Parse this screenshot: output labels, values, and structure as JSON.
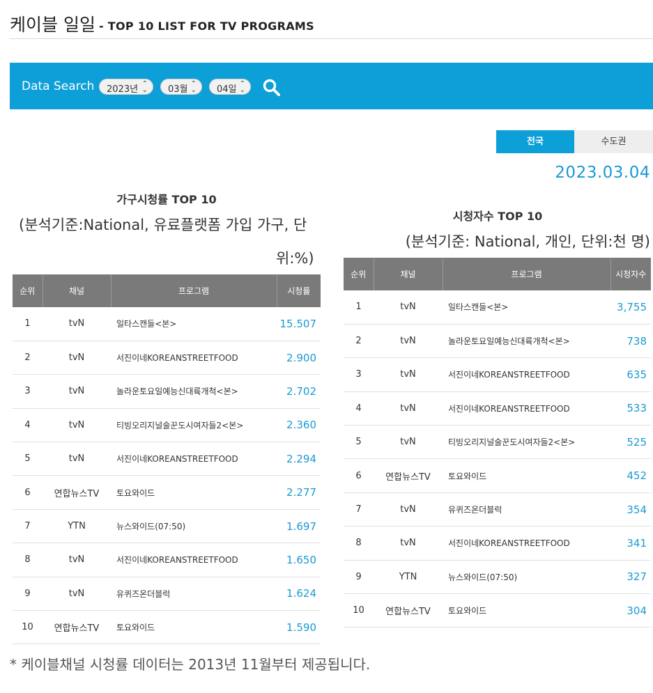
{
  "header": {
    "title_ko": "케이블 일일",
    "title_en": "- TOP 10 LIST FOR TV PROGRAMS"
  },
  "search": {
    "label": "Data Search",
    "year": "2023년",
    "month": "03월",
    "day": "04일",
    "icon": "search-icon"
  },
  "tabs": {
    "national": "전국",
    "capital": "수도권"
  },
  "date": "2023.03.04",
  "left": {
    "title": "가구시청률 TOP 10",
    "subtitle_line1": "(분석기준:National, 유료플랫폼 가입 가구, 단",
    "subtitle_line2": "위:%)",
    "columns": [
      "순위",
      "채널",
      "프로그램",
      "시청률"
    ],
    "rows": [
      {
        "rank": "1",
        "channel": "tvN",
        "program": "일타스캔들<본>",
        "value": "15.507"
      },
      {
        "rank": "2",
        "channel": "tvN",
        "program": "서진이네KOREANSTREETFOOD",
        "value": "2.900"
      },
      {
        "rank": "3",
        "channel": "tvN",
        "program": "놀라운토요일예능신대륙개척<본>",
        "value": "2.702"
      },
      {
        "rank": "4",
        "channel": "tvN",
        "program": "티빙오리지널술꾼도시여자들2<본>",
        "value": "2.360"
      },
      {
        "rank": "5",
        "channel": "tvN",
        "program": "서진이네KOREANSTREETFOOD",
        "value": "2.294"
      },
      {
        "rank": "6",
        "channel": "연합뉴스TV",
        "program": "토요와이드",
        "value": "2.277"
      },
      {
        "rank": "7",
        "channel": "YTN",
        "program": "뉴스와이드(07:50)",
        "value": "1.697"
      },
      {
        "rank": "8",
        "channel": "tvN",
        "program": "서진이네KOREANSTREETFOOD",
        "value": "1.650"
      },
      {
        "rank": "9",
        "channel": "tvN",
        "program": "유퀴즈온더블럭",
        "value": "1.624"
      },
      {
        "rank": "10",
        "channel": "연합뉴스TV",
        "program": "토요와이드",
        "value": "1.590"
      }
    ]
  },
  "right": {
    "title": "시청자수 TOP 10",
    "subtitle": "(분석기준: National, 개인, 단위:천 명)",
    "columns": [
      "순위",
      "채널",
      "프로그램",
      "시청자수"
    ],
    "rows": [
      {
        "rank": "1",
        "channel": "tvN",
        "program": "일타스캔들<본>",
        "value": "3,755"
      },
      {
        "rank": "2",
        "channel": "tvN",
        "program": "놀라운토요일예능신대륙개척<본>",
        "value": "738"
      },
      {
        "rank": "3",
        "channel": "tvN",
        "program": "서진이네KOREANSTREETFOOD",
        "value": "635"
      },
      {
        "rank": "4",
        "channel": "tvN",
        "program": "서진이네KOREANSTREETFOOD",
        "value": "533"
      },
      {
        "rank": "5",
        "channel": "tvN",
        "program": "티빙오리지널술꾼도시여자들2<본>",
        "value": "525"
      },
      {
        "rank": "6",
        "channel": "연합뉴스TV",
        "program": "토요와이드",
        "value": "452"
      },
      {
        "rank": "7",
        "channel": "tvN",
        "program": "유퀴즈온더블럭",
        "value": "354"
      },
      {
        "rank": "8",
        "channel": "tvN",
        "program": "서진이네KOREANSTREETFOOD",
        "value": "341"
      },
      {
        "rank": "9",
        "channel": "YTN",
        "program": "뉴스와이드(07:50)",
        "value": "327"
      },
      {
        "rank": "10",
        "channel": "연합뉴스TV",
        "program": "토요와이드",
        "value": "304"
      }
    ]
  },
  "footnote": "* 케이블채널 시청률 데이터는 2013년 11월부터 제공됩니다.",
  "colors": {
    "accent": "#0d9fd8",
    "value_text": "#1a9ad1",
    "table_header": "#7a7a7a"
  }
}
